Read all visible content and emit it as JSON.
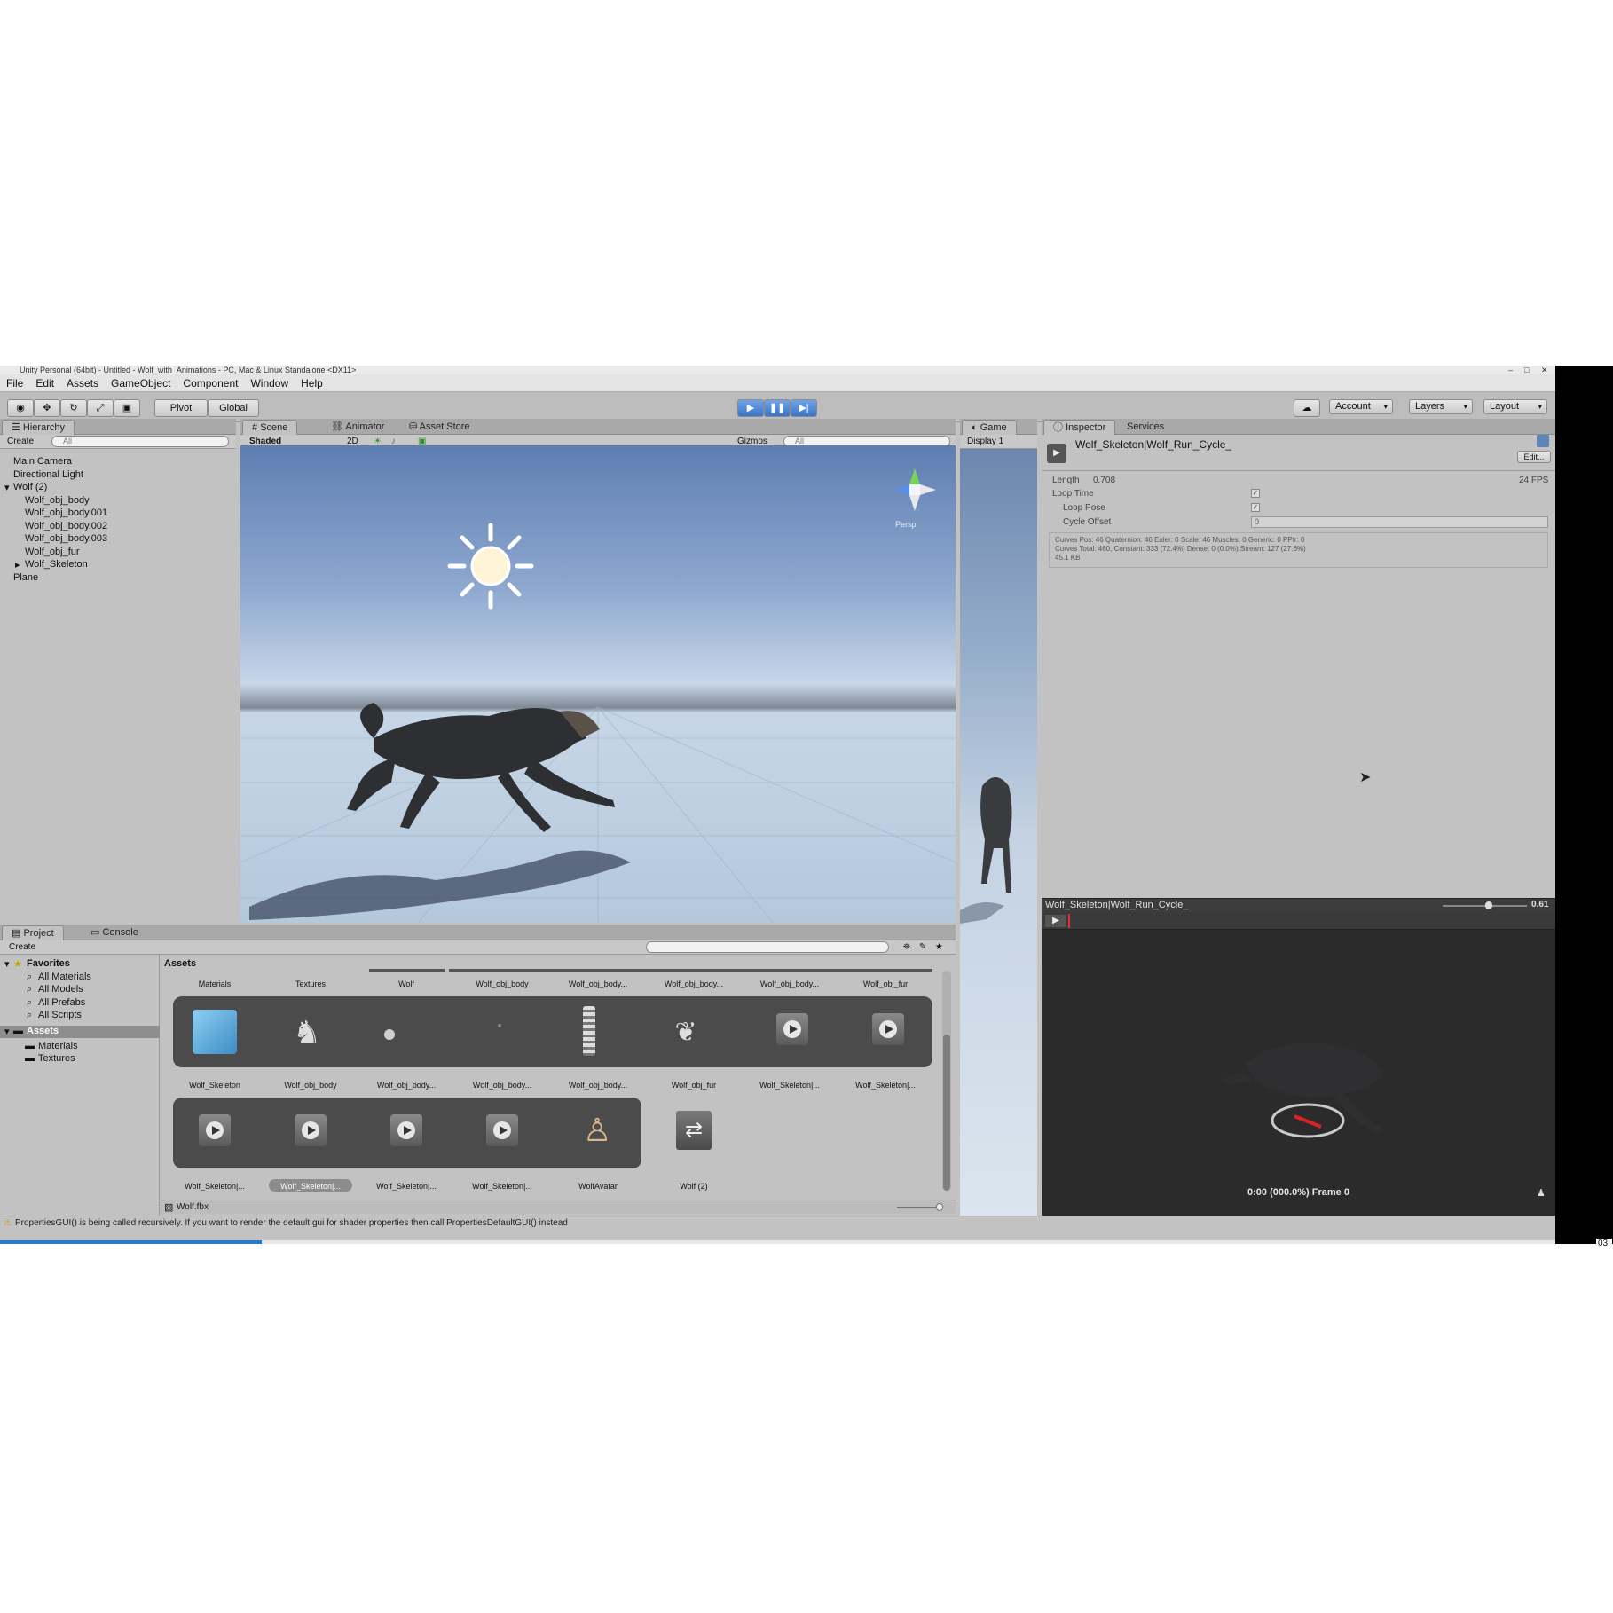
{
  "window": {
    "title": "Unity Personal (64bit) - Untitled - Wolf_with_Animations - PC, Mac & Linux Standalone <DX11>"
  },
  "menu": [
    "File",
    "Edit",
    "Assets",
    "GameObject",
    "Component",
    "Window",
    "Help"
  ],
  "toolbar": {
    "pivot_label": "Pivot",
    "global_label": "Global",
    "account_label": "Account",
    "layers_label": "Layers",
    "layout_label": "Layout"
  },
  "hierarchy": {
    "tab": "Hierarchy",
    "create": "Create",
    "search_placeholder": "All",
    "items": [
      "Main Camera",
      "Directional Light",
      "Wolf (2)",
      "Wolf_obj_body",
      "Wolf_obj_body.001",
      "Wolf_obj_body.002",
      "Wolf_obj_body.003",
      "Wolf_obj_fur",
      "Wolf_Skeleton",
      "Plane"
    ]
  },
  "scene": {
    "tabs": [
      "Scene",
      "Animator",
      "Asset Store"
    ],
    "shading": "Shaded",
    "mode_2d": "2D",
    "gizmos": "Gizmos",
    "search_placeholder": "All",
    "persp_label": "Persp"
  },
  "game": {
    "tab": "Game",
    "display": "Display 1"
  },
  "inspector": {
    "tabs": [
      "Inspector",
      "Services"
    ],
    "clip_name": "Wolf_Skeleton|Wolf_Run_Cycle_",
    "edit_button": "Edit...",
    "length_label": "Length",
    "length_value": "0.708",
    "fps": "24 FPS",
    "loop_time_label": "Loop Time",
    "loop_pose_label": "Loop Pose",
    "cycle_offset_label": "Cycle Offset",
    "cycle_offset_value": "0",
    "curves_info_1": "Curves Pos: 46 Quaternion: 46 Euler: 0 Scale: 46 Muscles: 0 Generic: 0 PPtr: 0",
    "curves_info_2": "Curves Total: 460, Constant: 333 (72.4%) Dense: 0 (0.0%) Stream: 127 (27.6%)",
    "curves_info_3": "45.1 KB"
  },
  "preview": {
    "title": "Wolf_Skeleton|Wolf_Run_Cycle_",
    "speed": "0.61",
    "time_label": "0:00 (000.0%) Frame 0"
  },
  "project": {
    "tabs": [
      "Project",
      "Console"
    ],
    "create": "Create",
    "favorites_label": "Favorites",
    "favorites": [
      "All Materials",
      "All Models",
      "All Prefabs",
      "All Scripts"
    ],
    "assets_root": "Assets",
    "assets_children": [
      "Materials",
      "Textures"
    ],
    "breadcrumb": "Assets",
    "row1_labels": [
      "Materials",
      "Textures",
      "Wolf",
      "Wolf_obj_body",
      "Wolf_obj_body...",
      "Wolf_obj_body...",
      "Wolf_obj_body...",
      "Wolf_obj_fur"
    ],
    "row2_labels": [
      "Wolf_Skeleton",
      "Wolf_obj_body",
      "Wolf_obj_body...",
      "Wolf_obj_body...",
      "Wolf_obj_body...",
      "Wolf_obj_fur",
      "Wolf_Skeleton|...",
      "Wolf_Skeleton|..."
    ],
    "row3_labels": [
      "Wolf_Skeleton|...",
      "Wolf_Skeleton|...",
      "Wolf_Skeleton|...",
      "Wolf_Skeleton|...",
      "WolfAvatar",
      "Wolf (2)"
    ],
    "selected_file": "Wolf.fbx"
  },
  "status": {
    "message": "PropertiesGUI() is being called recursively. If you want to render the default gui for shader properties then call PropertiesDefaultGUI() instead"
  },
  "video": {
    "progress_fraction": 0.165,
    "time": "03:"
  }
}
